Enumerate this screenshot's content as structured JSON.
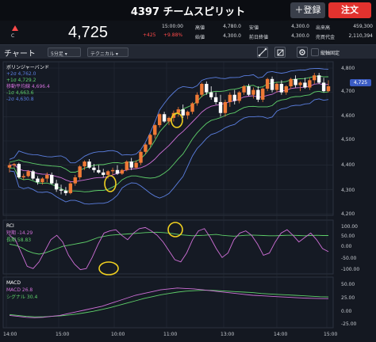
{
  "header": {
    "title": "4397  チームスピリット",
    "register_label": "＋登録",
    "order_label": "注文"
  },
  "quote": {
    "market_label": "C",
    "price": "4,725",
    "time": "15:00:00",
    "change": "+425",
    "change_pct": "+9.88%",
    "rows": [
      {
        "label_left": "高値",
        "value_left": "4,780.0",
        "label_mid": "安値",
        "value_mid": "4,300.0",
        "label_right": "出来高",
        "value_right": "459,300"
      },
      {
        "label_left": "始値",
        "value_left": "4,300.0",
        "label_mid": "前日終値",
        "value_mid": "4,300.0",
        "label_right": "売買代金",
        "value_right": "2,110,394"
      }
    ]
  },
  "toolbar": {
    "title": "チャート",
    "interval": "5分足",
    "technical": "テクニカル",
    "fixed_label": "縦軸固定"
  },
  "price_panel": {
    "legend": [
      {
        "text": "ボリンジャーバンド",
        "color": "#ffffff"
      },
      {
        "text": "+2σ 4,762.0",
        "color": "#5b7fe0"
      },
      {
        "text": "+1σ 4,729.2",
        "color": "#5fd06a"
      },
      {
        "text": "移動平均線 4,696.4",
        "color": "#d070d8"
      },
      {
        "text": "-1σ 4,663.6",
        "color": "#5fd06a"
      },
      {
        "text": "-2σ 4,630.8",
        "color": "#5b7fe0"
      }
    ],
    "y_ticks": [
      "4,800",
      "4,700",
      "4,600",
      "4,500",
      "4,400",
      "4,300",
      "4,200"
    ],
    "price_tag": "4,725"
  },
  "rci_panel": {
    "legend": [
      {
        "text": "RCI",
        "color": "#ffffff"
      },
      {
        "text": "短期 -14.29",
        "color": "#d070d8"
      },
      {
        "text": "長期 58.83",
        "color": "#5fd06a"
      }
    ],
    "y_ticks": [
      "100.00",
      "50.00",
      "0.00",
      "-50.00",
      "-100.00"
    ]
  },
  "macd_panel": {
    "legend": [
      {
        "text": "MACD",
        "color": "#ffffff"
      },
      {
        "text": "MACD 26.8",
        "color": "#d070d8"
      },
      {
        "text": "シグナル 30.4",
        "color": "#5fd06a"
      }
    ],
    "y_ticks": [
      "50.00",
      "25.00",
      "0.00",
      "-25.00"
    ]
  },
  "x_ticks": [
    "14:00",
    "15:00",
    "10:00",
    "11:00",
    "13:00",
    "14:00",
    "15:00"
  ],
  "colors": {
    "up": "#f07a36",
    "down": "#ffffff",
    "upper": "#5b7fe0",
    "mid": "#d070d8",
    "inner": "#5fd06a",
    "annotation": "#f0d020"
  },
  "chart_data": [
    {
      "type": "candlestick",
      "candles": [
        [
          4390,
          4410,
          4370,
          4400
        ],
        [
          4400,
          4410,
          4390,
          4405
        ],
        [
          4405,
          4410,
          4345,
          4350
        ],
        [
          4350,
          4365,
          4340,
          4355
        ],
        [
          4355,
          4380,
          4350,
          4375
        ],
        [
          4375,
          4380,
          4340,
          4345
        ],
        [
          4345,
          4355,
          4320,
          4330
        ],
        [
          4330,
          4350,
          4320,
          4345
        ],
        [
          4345,
          4370,
          4330,
          4360
        ],
        [
          4360,
          4370,
          4320,
          4325
        ],
        [
          4325,
          4340,
          4290,
          4300
        ],
        [
          4300,
          4320,
          4280,
          4295
        ],
        [
          4295,
          4310,
          4275,
          4285
        ],
        [
          4285,
          4330,
          4280,
          4325
        ],
        [
          4325,
          4360,
          4315,
          4350
        ],
        [
          4350,
          4400,
          4340,
          4395
        ],
        [
          4395,
          4420,
          4380,
          4415
        ],
        [
          4415,
          4425,
          4385,
          4390
        ],
        [
          4390,
          4405,
          4370,
          4380
        ],
        [
          4380,
          4400,
          4365,
          4370
        ],
        [
          4370,
          4385,
          4350,
          4360
        ],
        [
          4360,
          4380,
          4345,
          4375
        ],
        [
          4375,
          4390,
          4360,
          4380
        ],
        [
          4380,
          4400,
          4360,
          4365
        ],
        [
          4365,
          4385,
          4360,
          4380
        ],
        [
          4380,
          4420,
          4375,
          4415
        ],
        [
          4415,
          4430,
          4380,
          4390
        ],
        [
          4390,
          4420,
          4385,
          4410
        ],
        [
          4410,
          4460,
          4400,
          4455
        ],
        [
          4455,
          4490,
          4445,
          4485
        ],
        [
          4485,
          4530,
          4475,
          4525
        ],
        [
          4525,
          4570,
          4510,
          4565
        ],
        [
          4565,
          4615,
          4555,
          4610
        ],
        [
          4610,
          4620,
          4575,
          4580
        ],
        [
          4580,
          4600,
          4565,
          4595
        ],
        [
          4595,
          4625,
          4580,
          4615
        ],
        [
          4615,
          4640,
          4600,
          4630
        ],
        [
          4630,
          4650,
          4595,
          4605
        ],
        [
          4605,
          4625,
          4590,
          4620
        ],
        [
          4620,
          4660,
          4610,
          4655
        ],
        [
          4655,
          4700,
          4645,
          4690
        ],
        [
          4690,
          4740,
          4680,
          4735
        ],
        [
          4735,
          4745,
          4690,
          4700
        ],
        [
          4700,
          4725,
          4670,
          4680
        ],
        [
          4680,
          4700,
          4650,
          4660
        ],
        [
          4660,
          4690,
          4600,
          4615
        ],
        [
          4615,
          4670,
          4600,
          4660
        ],
        [
          4660,
          4700,
          4640,
          4690
        ],
        [
          4690,
          4710,
          4650,
          4665
        ],
        [
          4665,
          4705,
          4655,
          4700
        ],
        [
          4700,
          4730,
          4690,
          4725
        ],
        [
          4725,
          4735,
          4685,
          4690
        ],
        [
          4690,
          4720,
          4675,
          4710
        ],
        [
          4710,
          4725,
          4660,
          4670
        ],
        [
          4670,
          4720,
          4660,
          4715
        ],
        [
          4715,
          4760,
          4705,
          4755
        ],
        [
          4755,
          4765,
          4700,
          4710
        ],
        [
          4710,
          4740,
          4700,
          4735
        ],
        [
          4735,
          4750,
          4690,
          4700
        ],
        [
          4700,
          4730,
          4690,
          4725
        ],
        [
          4725,
          4760,
          4715,
          4755
        ],
        [
          4755,
          4770,
          4720,
          4730
        ],
        [
          4730,
          4745,
          4705,
          4740
        ],
        [
          4740,
          4760,
          4715,
          4720
        ],
        [
          4720,
          4760,
          4710,
          4750
        ],
        [
          4750,
          4780,
          4735,
          4770
        ],
        [
          4770,
          4780,
          4735,
          4740
        ],
        [
          4740,
          4760,
          4700,
          4705
        ],
        [
          4705,
          4750,
          4700,
          4725
        ]
      ],
      "ylim": [
        4200,
        4820
      ]
    }
  ]
}
